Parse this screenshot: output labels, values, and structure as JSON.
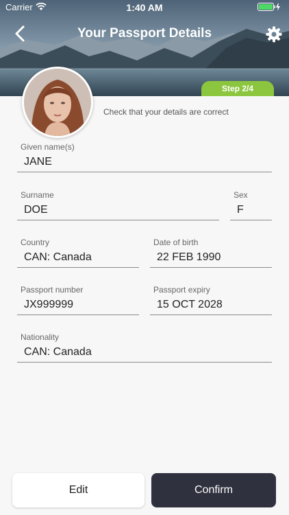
{
  "status_bar": {
    "carrier": "Carrier",
    "time": "1:40 AM",
    "icons": [
      "wifi-icon",
      "battery-icon"
    ]
  },
  "nav": {
    "title": "Your Passport Details",
    "back_icon": "chevron-left-icon",
    "settings_icon": "gear-icon"
  },
  "step": {
    "label": "Step 2/4"
  },
  "instructions": "Check that your details are correct",
  "fields": {
    "given_name": {
      "label": "Given name(s)",
      "value": "JANE"
    },
    "surname": {
      "label": "Surname",
      "value": "DOE"
    },
    "sex": {
      "label": "Sex",
      "value": "F"
    },
    "country": {
      "label": "Country",
      "value": "CAN: Canada"
    },
    "date_of_birth": {
      "label": "Date of birth",
      "value": "22 FEB 1990"
    },
    "passport_number": {
      "label": "Passport number",
      "value": "JX999999"
    },
    "passport_expiry": {
      "label": "Passport expiry",
      "value": "15 OCT 2028"
    },
    "nationality": {
      "label": "Nationality",
      "value": "CAN: Canada"
    }
  },
  "buttons": {
    "edit": "Edit",
    "confirm": "Confirm"
  },
  "colors": {
    "accent_green": "#8cc63f",
    "confirm_dark": "#30313f",
    "background": "#f7f7f7"
  }
}
